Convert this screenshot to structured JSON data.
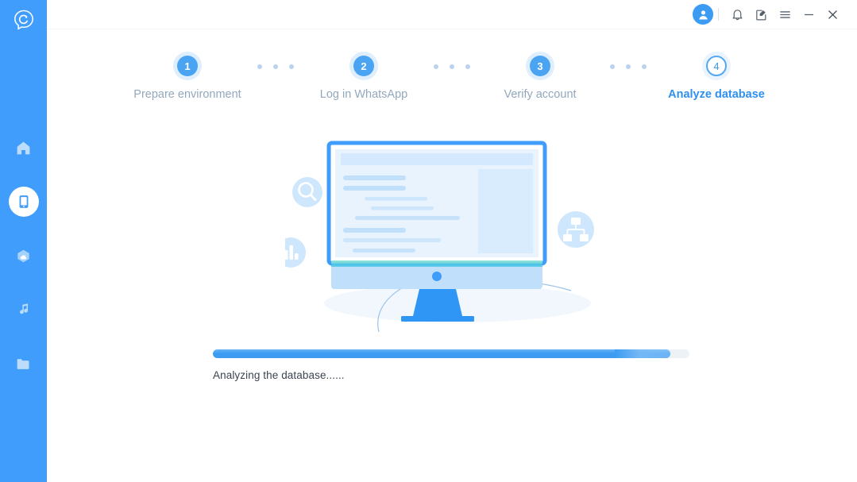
{
  "app": {
    "logo_icon": "app-logo-icon",
    "background": "#409dfb",
    "accent": "#3d9cf2"
  },
  "sidebar": {
    "items": [
      {
        "icon": "home-icon",
        "name": "sidebar-item-home",
        "active": false
      },
      {
        "icon": "phone-icon",
        "name": "sidebar-item-device",
        "active": true
      },
      {
        "icon": "cloud-icon",
        "name": "sidebar-item-cloud",
        "active": false
      },
      {
        "icon": "music-icon",
        "name": "sidebar-item-music",
        "active": false
      },
      {
        "icon": "folder-icon",
        "name": "sidebar-item-files",
        "active": false
      }
    ]
  },
  "titlebar": {
    "avatar_icon": "user-avatar-icon",
    "controls": [
      {
        "icon": "bell-icon",
        "name": "notifications-button"
      },
      {
        "icon": "feedback-icon",
        "name": "feedback-button"
      },
      {
        "icon": "menu-icon",
        "name": "menu-button"
      },
      {
        "icon": "minimize-icon",
        "name": "minimize-button"
      },
      {
        "icon": "close-icon",
        "name": "close-button"
      }
    ]
  },
  "stepper": {
    "steps": [
      {
        "number": "1",
        "label": "Prepare environment",
        "state": "done"
      },
      {
        "number": "2",
        "label": "Log in WhatsApp",
        "state": "done"
      },
      {
        "number": "3",
        "label": "Verify account",
        "state": "done"
      },
      {
        "number": "4",
        "label": "Analyze database",
        "state": "active"
      }
    ],
    "active_index": 3,
    "done_color": "#93a8bd",
    "active_color": "#2f90ee"
  },
  "illustration": {
    "name": "database-analysis-illustration",
    "floating_icons": [
      {
        "icon": "search-icon",
        "name": "illustration-search-icon"
      },
      {
        "icon": "chart-icon",
        "name": "illustration-chart-icon"
      },
      {
        "icon": "sitemap-icon",
        "name": "illustration-network-icon"
      }
    ],
    "scan_line_color": "#5fd6c8"
  },
  "progress": {
    "percent": 96,
    "status_text": "Analyzing the database......",
    "fill_color": "#3d9cf2",
    "track_color": "#edf2f6"
  }
}
